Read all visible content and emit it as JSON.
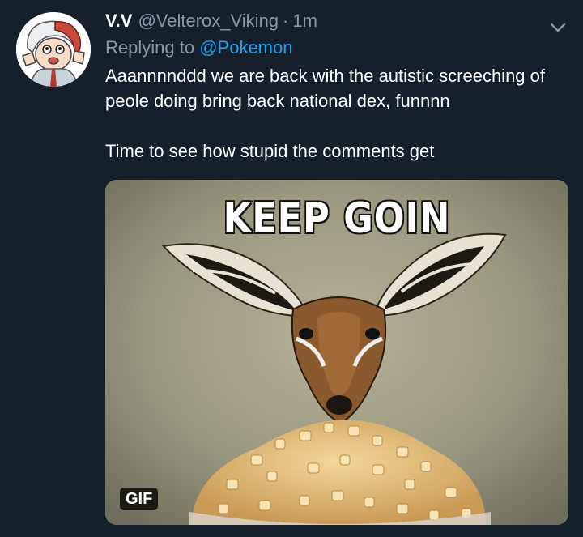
{
  "tweet": {
    "display_name": "V.V",
    "handle": "@Velterox_Viking",
    "separator": "·",
    "time": "1m",
    "reply_prefix": "Replying to",
    "reply_mention": "@Pokemon",
    "text_line1": "Aaannnnddd we are back with the autistic screeching of peole doing bring back national dex, funnnn",
    "text_line2": "Time to see how stupid the comments get",
    "media": {
      "caption": "KEEP GOIN",
      "badge": "GIF"
    },
    "icons": {
      "more": "chevron-down-icon"
    },
    "colors": {
      "background": "#15202b",
      "text": "#ffffff",
      "muted": "#8899a6",
      "link": "#1da1f2"
    }
  }
}
